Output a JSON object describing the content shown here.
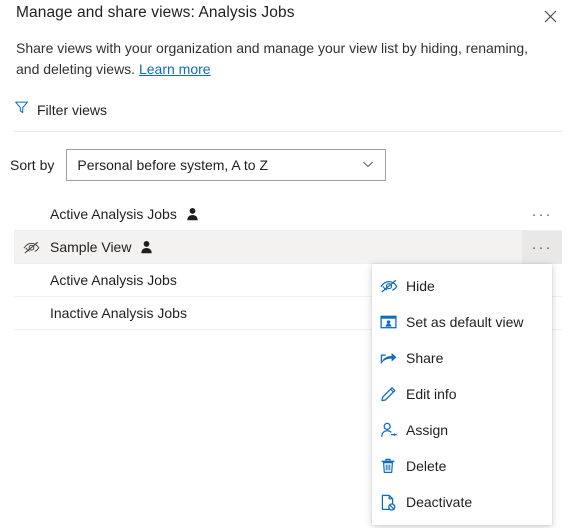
{
  "dialog": {
    "title": "Manage and share views: Analysis Jobs",
    "close_icon": "close-icon",
    "description_part1": "Share views with your organization and manage your view list by hiding, renaming, and deleting views.",
    "learn_more": "Learn more"
  },
  "filter": {
    "icon": "filter-funnel-icon",
    "label": "Filter views"
  },
  "sort": {
    "label": "Sort by",
    "value": "Personal before system, A to Z",
    "chevron_icon": "chevron-down-icon"
  },
  "list": {
    "rows": [
      {
        "label": "Active Analysis Jobs",
        "hidden_icon": false,
        "personal": true,
        "selected": false,
        "overflow_label": "···"
      },
      {
        "label": "Sample View",
        "hidden_icon": true,
        "personal": true,
        "selected": true,
        "overflow_label": "···"
      },
      {
        "label": "Active Analysis Jobs",
        "hidden_icon": false,
        "personal": false,
        "selected": false,
        "overflow_label": "···"
      },
      {
        "label": "Inactive Analysis Jobs",
        "hidden_icon": false,
        "personal": false,
        "selected": false,
        "overflow_label": "···"
      }
    ]
  },
  "context_menu": {
    "items": [
      {
        "label": "Hide",
        "icon": "eye-hidden-icon"
      },
      {
        "label": "Set as default view",
        "icon": "default-view-icon"
      },
      {
        "label": "Share",
        "icon": "share-icon"
      },
      {
        "label": "Edit info",
        "icon": "pencil-edit-icon"
      },
      {
        "label": "Assign",
        "icon": "person-assign-icon"
      },
      {
        "label": "Delete",
        "icon": "trash-delete-icon"
      },
      {
        "label": "Deactivate",
        "icon": "document-deactivate-icon"
      }
    ]
  },
  "colors": {
    "accent": "#0f6cbd",
    "text": "#201f1e",
    "selected_row": "#f3f2f1",
    "divider": "#e6e6e6"
  }
}
